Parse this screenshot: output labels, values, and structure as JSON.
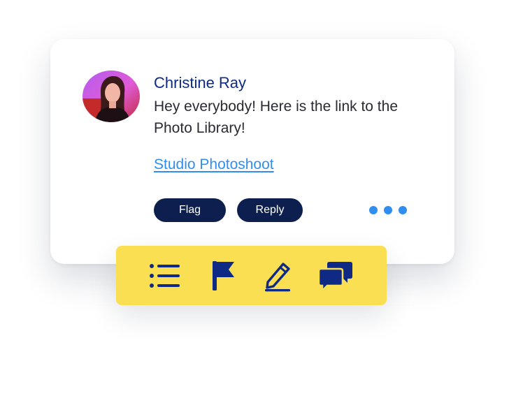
{
  "comment": {
    "author": "Christine Ray",
    "message": "Hey everybody! Here is the link to the Photo Library!",
    "link_text": "Studio Photoshoot",
    "avatar": "profile-photo",
    "actions": {
      "flag_label": "Flag",
      "reply_label": "Reply",
      "more_icon": "ellipsis-icon"
    }
  },
  "toolbar": {
    "tools": [
      {
        "icon": "list-icon"
      },
      {
        "icon": "flag-icon"
      },
      {
        "icon": "edit-icon"
      },
      {
        "icon": "chat-icon"
      }
    ]
  },
  "colors": {
    "author_name": "#0e2a84",
    "link": "#2f8ef0",
    "pill_bg": "#0d1f4e",
    "toolbar_bg": "#fbdf52",
    "icon": "#0e2a84"
  }
}
